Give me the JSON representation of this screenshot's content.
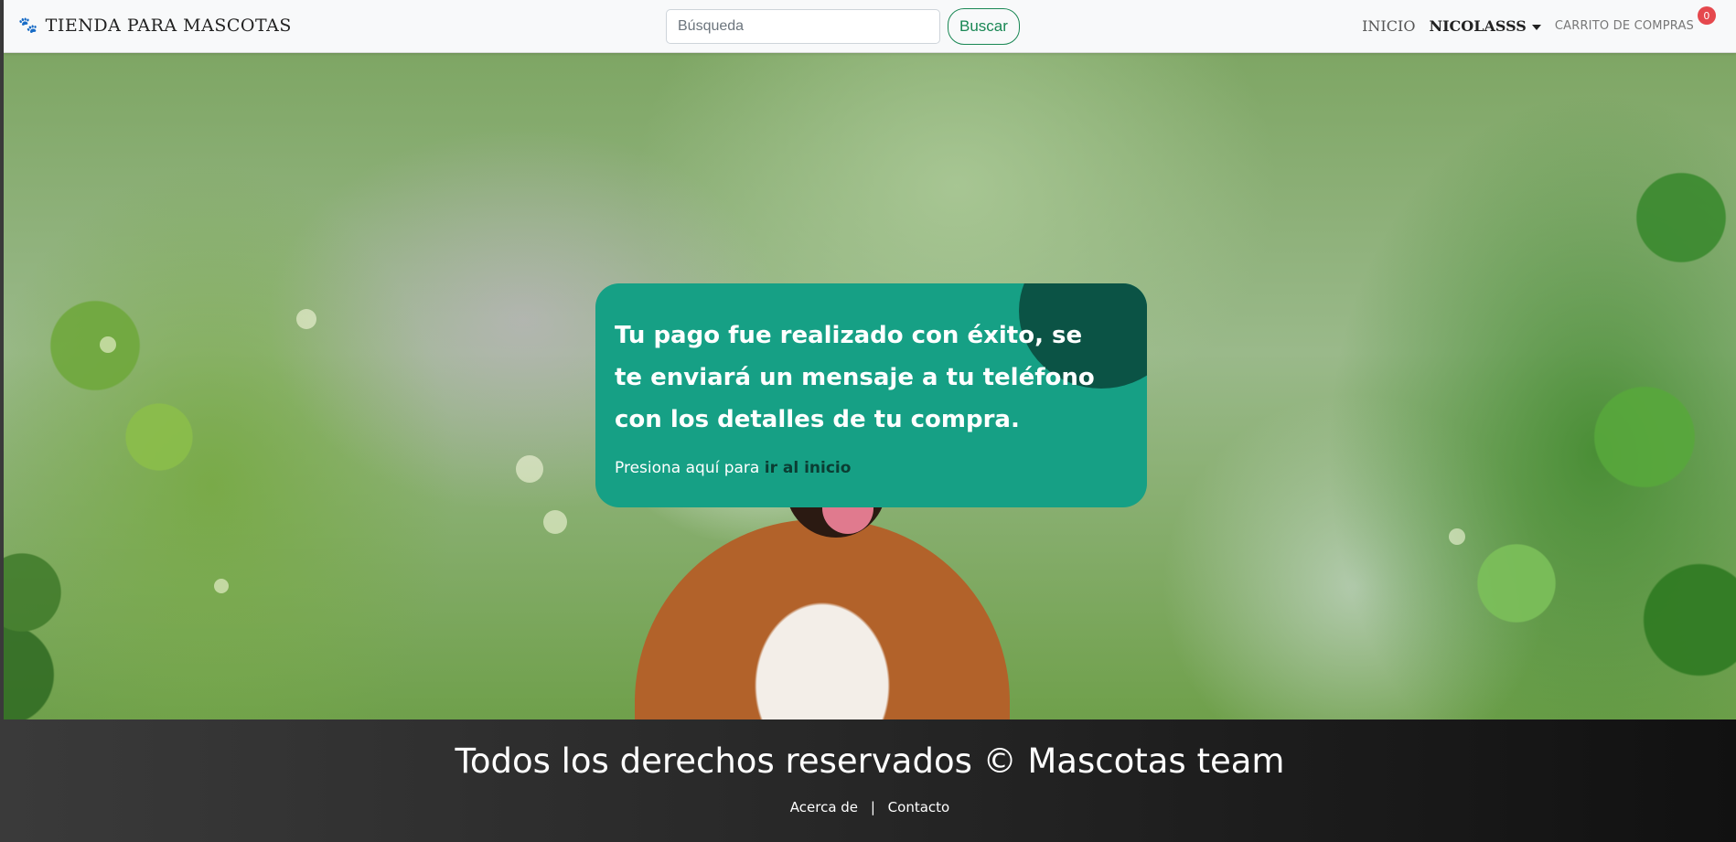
{
  "navbar": {
    "brand": "TIENDA PARA MASCOTAS",
    "brand_icon": "paw-icon",
    "search": {
      "placeholder": "Búsqueda",
      "button_label": "Buscar"
    },
    "links": {
      "home": "INICIO",
      "user": "NICOLASSS",
      "cart": "CARRITO DE COMPRAS",
      "cart_count": "0"
    }
  },
  "card": {
    "title": "Tu pago fue realizado con éxito, se te enviará un mensaje a tu teléfono con los detalles de tu compra.",
    "text_prefix": "Presiona aquí para",
    "link_label": "ir al inicio",
    "accent_color": "#16a085",
    "corner_color": "#0b5345"
  },
  "footer": {
    "title": "Todos los derechos reservados © Mascotas team",
    "links": {
      "about": "Acerca de",
      "separator": "|",
      "contact": "Contacto"
    }
  }
}
